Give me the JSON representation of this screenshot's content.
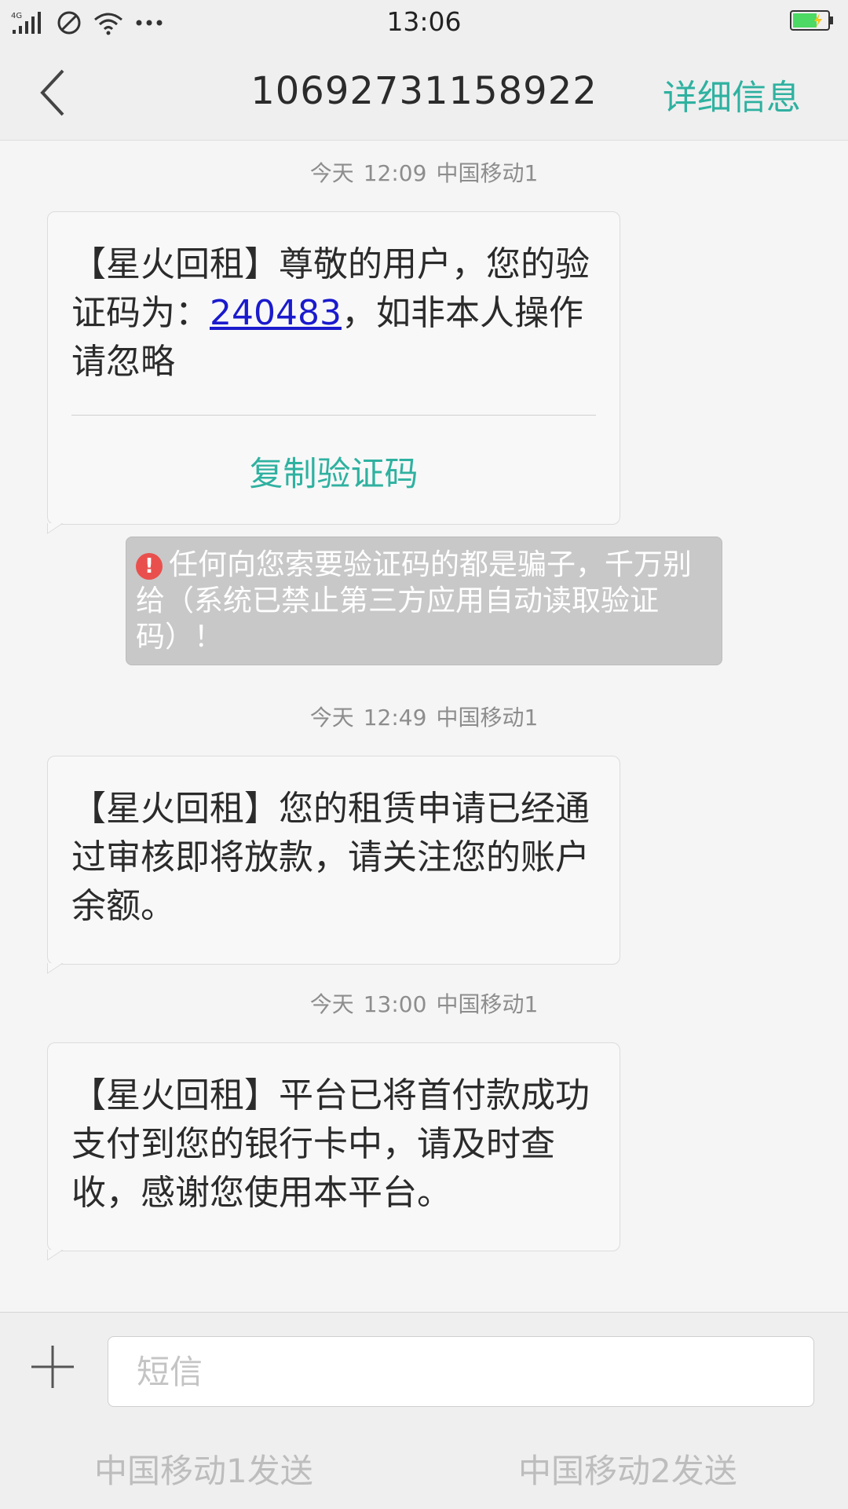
{
  "status_bar": {
    "network": "4G",
    "time": "13:06",
    "icons": [
      "signal-icon",
      "do-not-disturb-icon",
      "wifi-icon",
      "more-icon",
      "battery-charging-icon"
    ]
  },
  "header": {
    "title": "10692731158922",
    "detail_label": "详细信息"
  },
  "messages": [
    {
      "timestamp": {
        "day": "今天",
        "time": "12:09",
        "sim": "中国移动1"
      },
      "text_before": "【星火回租】尊敬的用户，您的验证码为：",
      "code": "240483",
      "text_after": "，如非本人操作请忽略",
      "action_label": "复制验证码"
    },
    {
      "timestamp": {
        "day": "今天",
        "time": "12:49",
        "sim": "中国移动1"
      },
      "text": "【星火回租】您的租赁申请已经通过审核即将放款，请关注您的账户余额。"
    },
    {
      "timestamp": {
        "day": "今天",
        "time": "13:00",
        "sim": "中国移动1"
      },
      "text": "【星火回租】平台已将首付款成功支付到您的银行卡中，请及时查收，感谢您使用本平台。"
    }
  ],
  "warning": {
    "icon": "!",
    "text": "任何向您索要验证码的都是骗子，千万别给（系统已禁止第三方应用自动读取验证码）！"
  },
  "compose": {
    "placeholder": "短信",
    "value": "",
    "send_sim1": "中国移动1发送",
    "send_sim2": "中国移动2发送"
  },
  "colors": {
    "accent": "#2fb1a0",
    "link": "#1a1acd",
    "warning_bg": "#c8c8c8",
    "warning_icon": "#e9504d"
  }
}
